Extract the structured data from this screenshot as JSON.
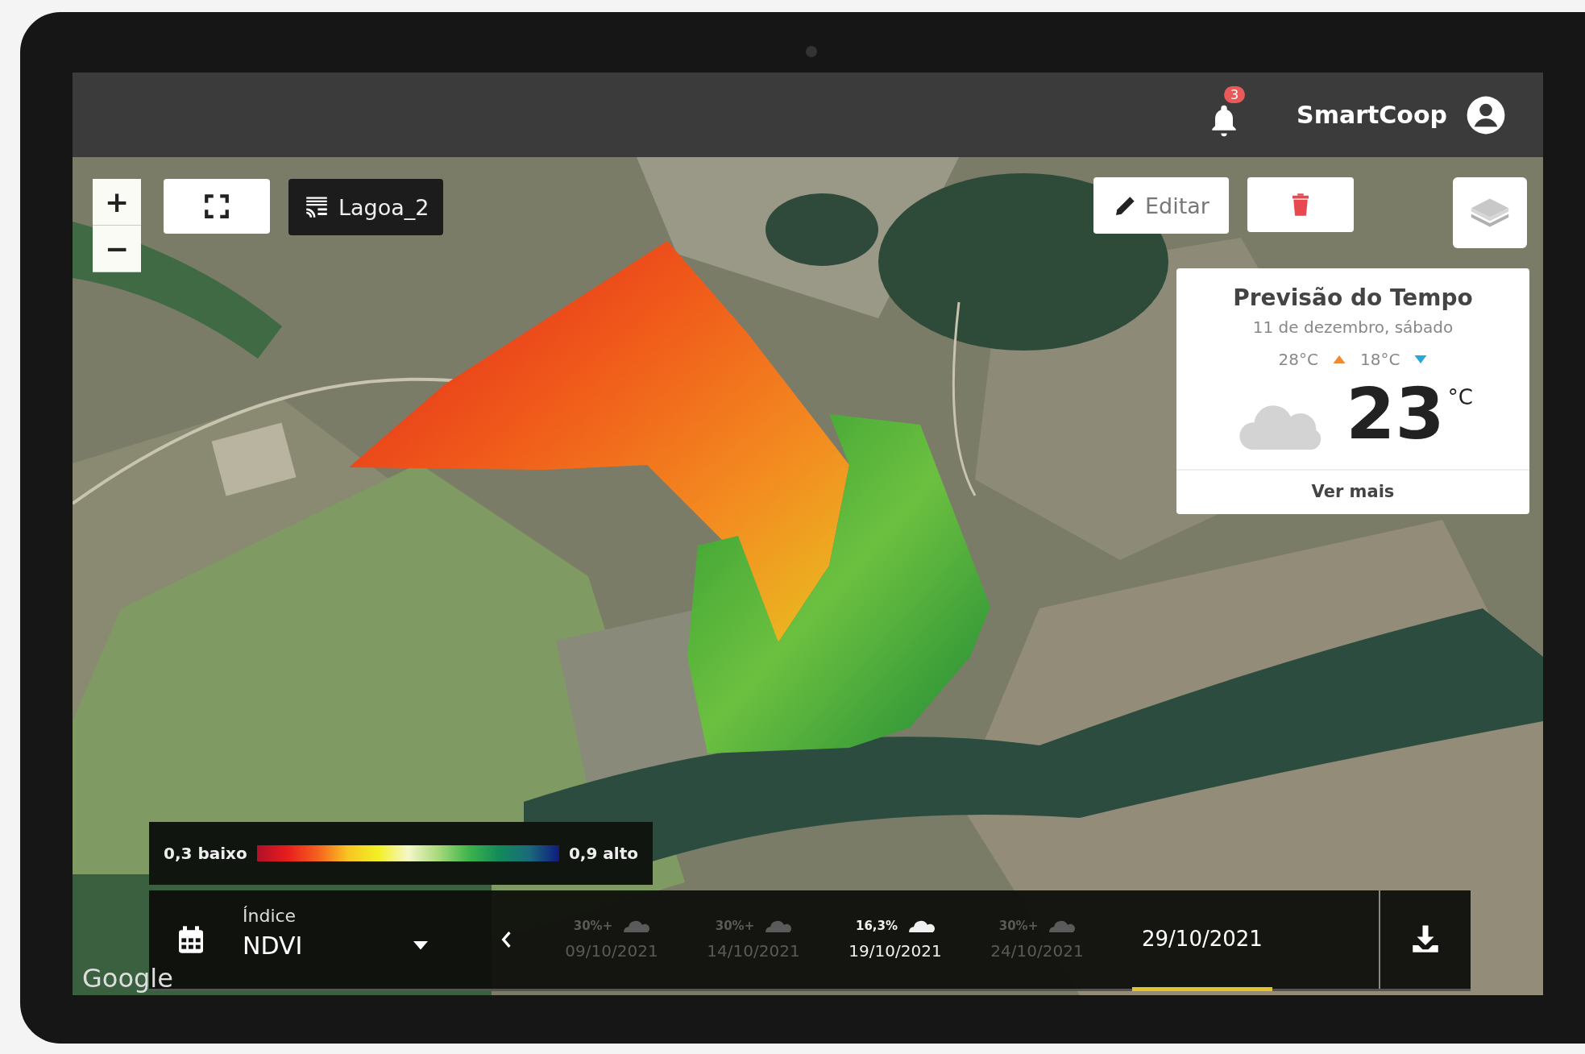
{
  "header": {
    "notification_count": "3",
    "user": "SmartCoop"
  },
  "map_controls": {
    "zoom_in": "+",
    "zoom_out": "−",
    "layer_name": "Lagoa_2",
    "edit_button": "Editar"
  },
  "weather": {
    "title": "Previsão do Tempo",
    "date": "11 de dezembro, sábado",
    "max": "28°C",
    "min": "18°C",
    "temperature": "23",
    "unit": "°C",
    "link": "Ver mais"
  },
  "legend": {
    "low": "0,3 baixo",
    "high": "0,9 alto"
  },
  "index": {
    "label": "Índice",
    "value": "NDVI"
  },
  "timeline": [
    {
      "cloud": "30%+",
      "date": "09/10/2021",
      "selected": false
    },
    {
      "cloud": "30%+",
      "date": "14/10/2021",
      "selected": false
    },
    {
      "cloud": "16,3%",
      "date": "19/10/2021",
      "selected": true
    },
    {
      "cloud": "30%+",
      "date": "24/10/2021",
      "selected": false
    }
  ],
  "current_date": "29/10/2021",
  "map_credit": "Google"
}
